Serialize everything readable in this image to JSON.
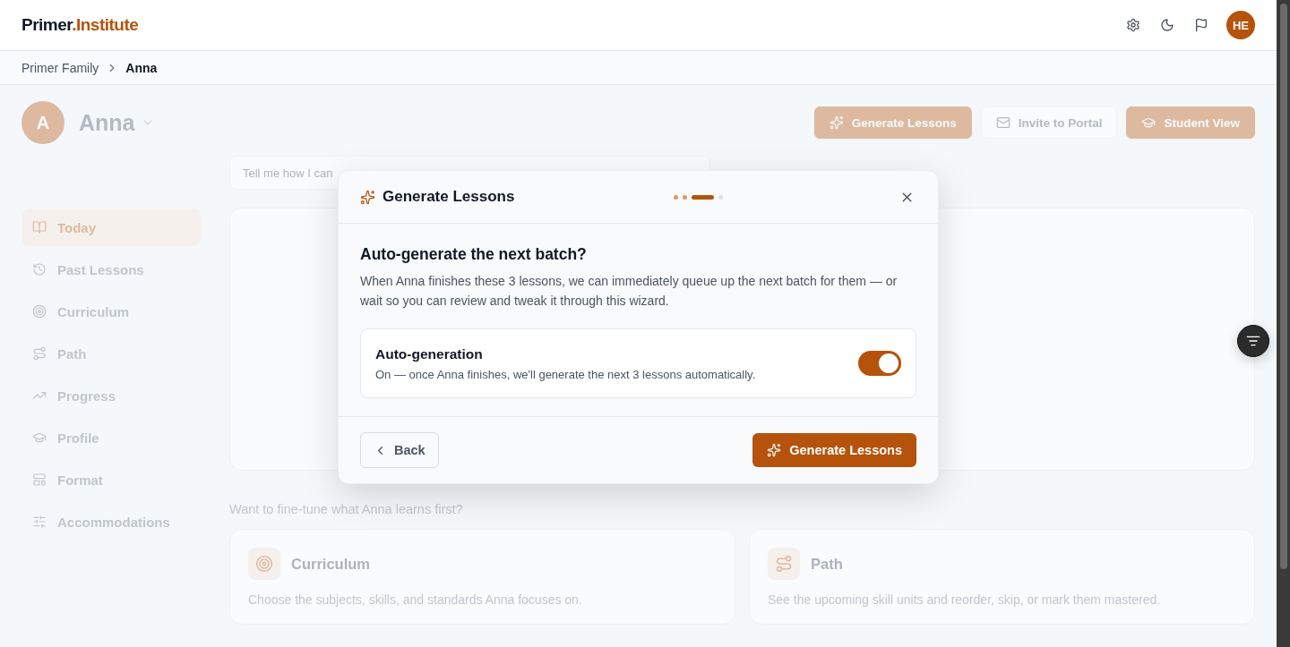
{
  "header": {
    "logo_main": "Primer",
    "logo_accent": ".Institute",
    "avatar": "HE"
  },
  "breadcrumb": [
    {
      "label": "Primer Family",
      "current": false
    },
    {
      "label": "Anna",
      "current": true
    }
  ],
  "student": {
    "initial": "A",
    "name": "Anna"
  },
  "actions": [
    {
      "label": "Generate Lessons",
      "kind": "primary"
    },
    {
      "label": "Invite to Portal",
      "kind": "secondary"
    },
    {
      "label": "Student View",
      "kind": "primary"
    }
  ],
  "ask": {
    "placeholder": "Tell me how I can"
  },
  "sidebar": {
    "items": [
      {
        "label": "Today",
        "selected": true
      },
      {
        "label": "Past Lessons",
        "selected": false
      },
      {
        "label": "Curriculum",
        "selected": false
      },
      {
        "label": "Path",
        "selected": false
      },
      {
        "label": "Progress",
        "selected": false
      },
      {
        "label": "Profile",
        "selected": false
      },
      {
        "label": "Format",
        "selected": false
      },
      {
        "label": "Accommodations",
        "selected": false
      }
    ]
  },
  "fine_tune": {
    "prompt": "Want to fine-tune what Anna learns first?",
    "cards": [
      {
        "title": "Curriculum",
        "text": "Choose the subjects, skills, and standards Anna focuses on."
      },
      {
        "title": "Path",
        "text": "See the upcoming skill units and reorder, skip, or mark them mastered."
      }
    ]
  },
  "dialog": {
    "title": "Generate Lessons",
    "steps": [
      {
        "done": true,
        "selected": false
      },
      {
        "done": true,
        "selected": false
      },
      {
        "done": false,
        "selected": true
      },
      {
        "done": false,
        "selected": false
      }
    ],
    "heading": "Auto-generate the next batch?",
    "text": "When Anna finishes these 3 lessons, we can immediately queue up the next batch for them — or wait so you can review and tweak it through this wizard.",
    "setting": {
      "label": "Auto-generation",
      "description": "On — once Anna finishes, we'll generate the next 3 lessons automatically.",
      "on": true
    },
    "back": "Back",
    "confirm": "Generate Lessons"
  }
}
